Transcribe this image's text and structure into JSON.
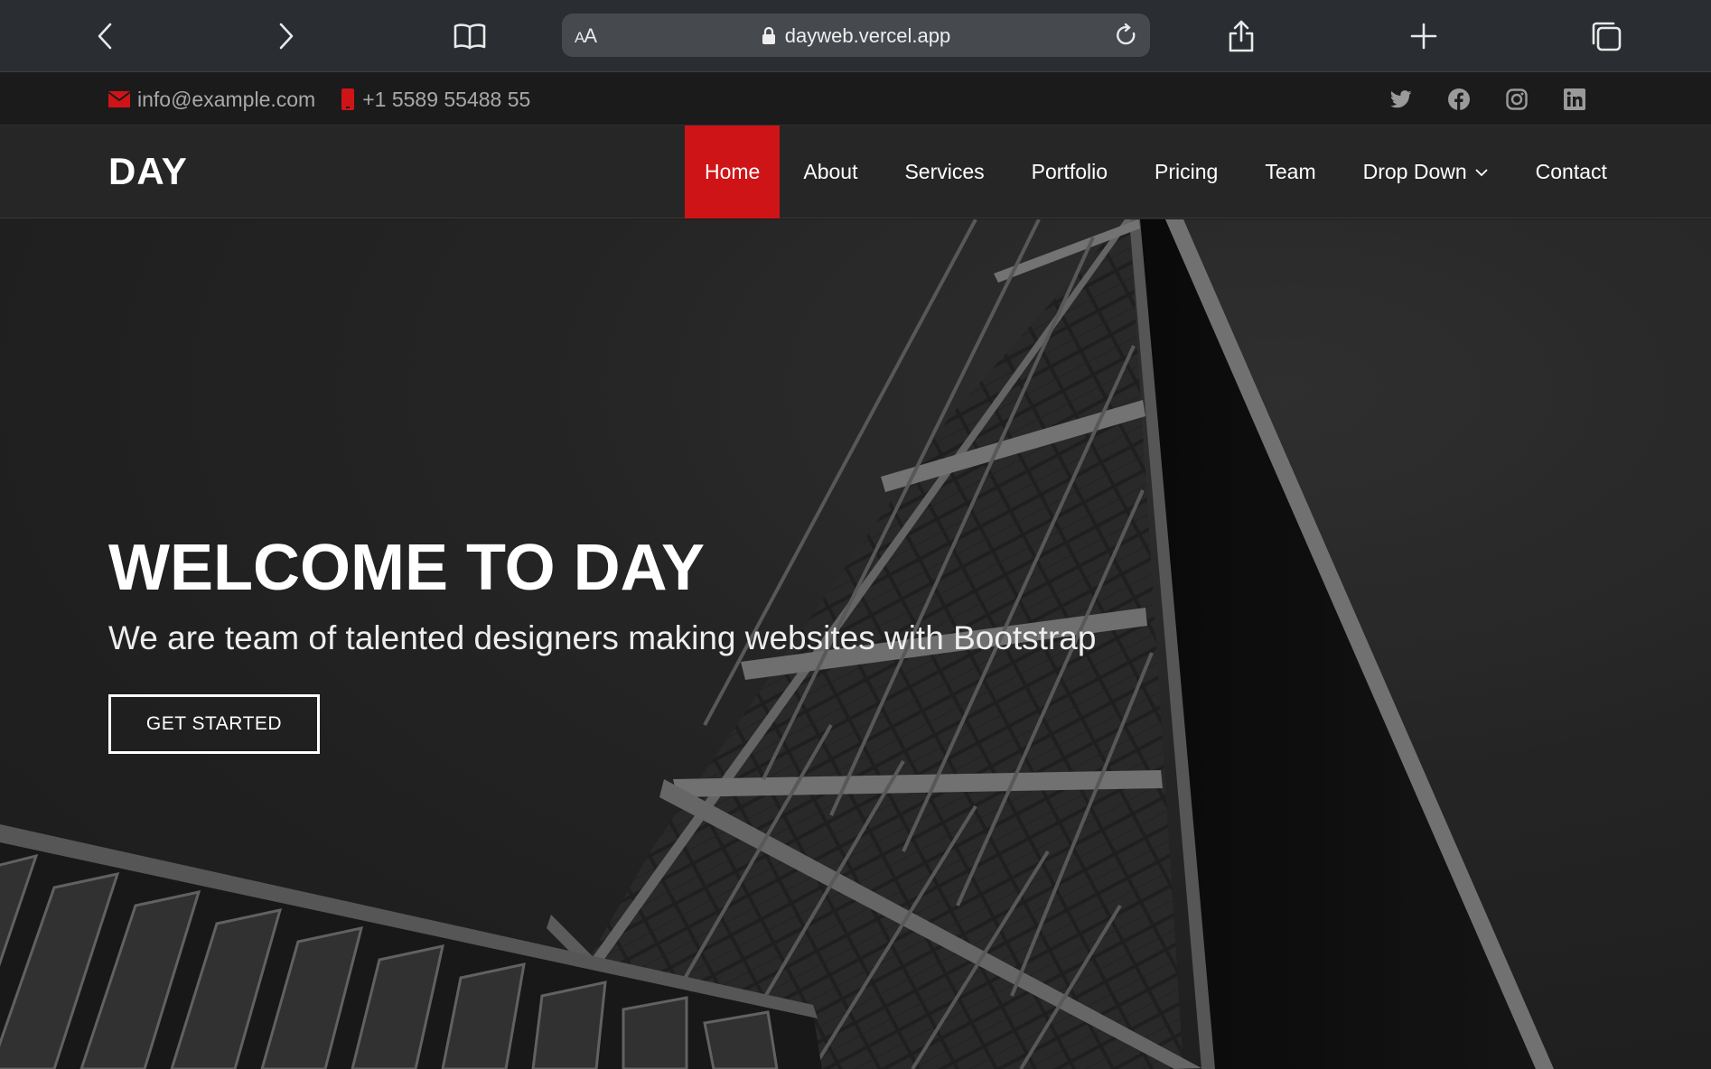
{
  "browser": {
    "url_text": "dayweb.vercel.app",
    "reader_label_big": "A",
    "reader_label_small": "A",
    "icons": [
      "chevron-left-icon",
      "chevron-right-icon",
      "book-icon",
      "lock-icon",
      "reload-icon",
      "share-icon",
      "plus-icon",
      "tabs-icon"
    ]
  },
  "topbar": {
    "email": "info@example.com",
    "phone": "+1 5589 55488 55",
    "social": [
      "twitter-icon",
      "facebook-icon",
      "instagram-icon",
      "linkedin-icon"
    ],
    "accent_color": "#cf1417"
  },
  "header": {
    "logo": "DAY",
    "nav": {
      "home": "Home",
      "about": "About",
      "services": "Services",
      "portfolio": "Portfolio",
      "pricing": "Pricing",
      "team": "Team",
      "dropdown": "Drop Down",
      "contact": "Contact"
    },
    "active_item": "Home"
  },
  "hero": {
    "title": "WELCOME TO DAY",
    "subtitle": "We are team of talented designers making websites with Bootstrap",
    "cta": "GET STARTED"
  }
}
